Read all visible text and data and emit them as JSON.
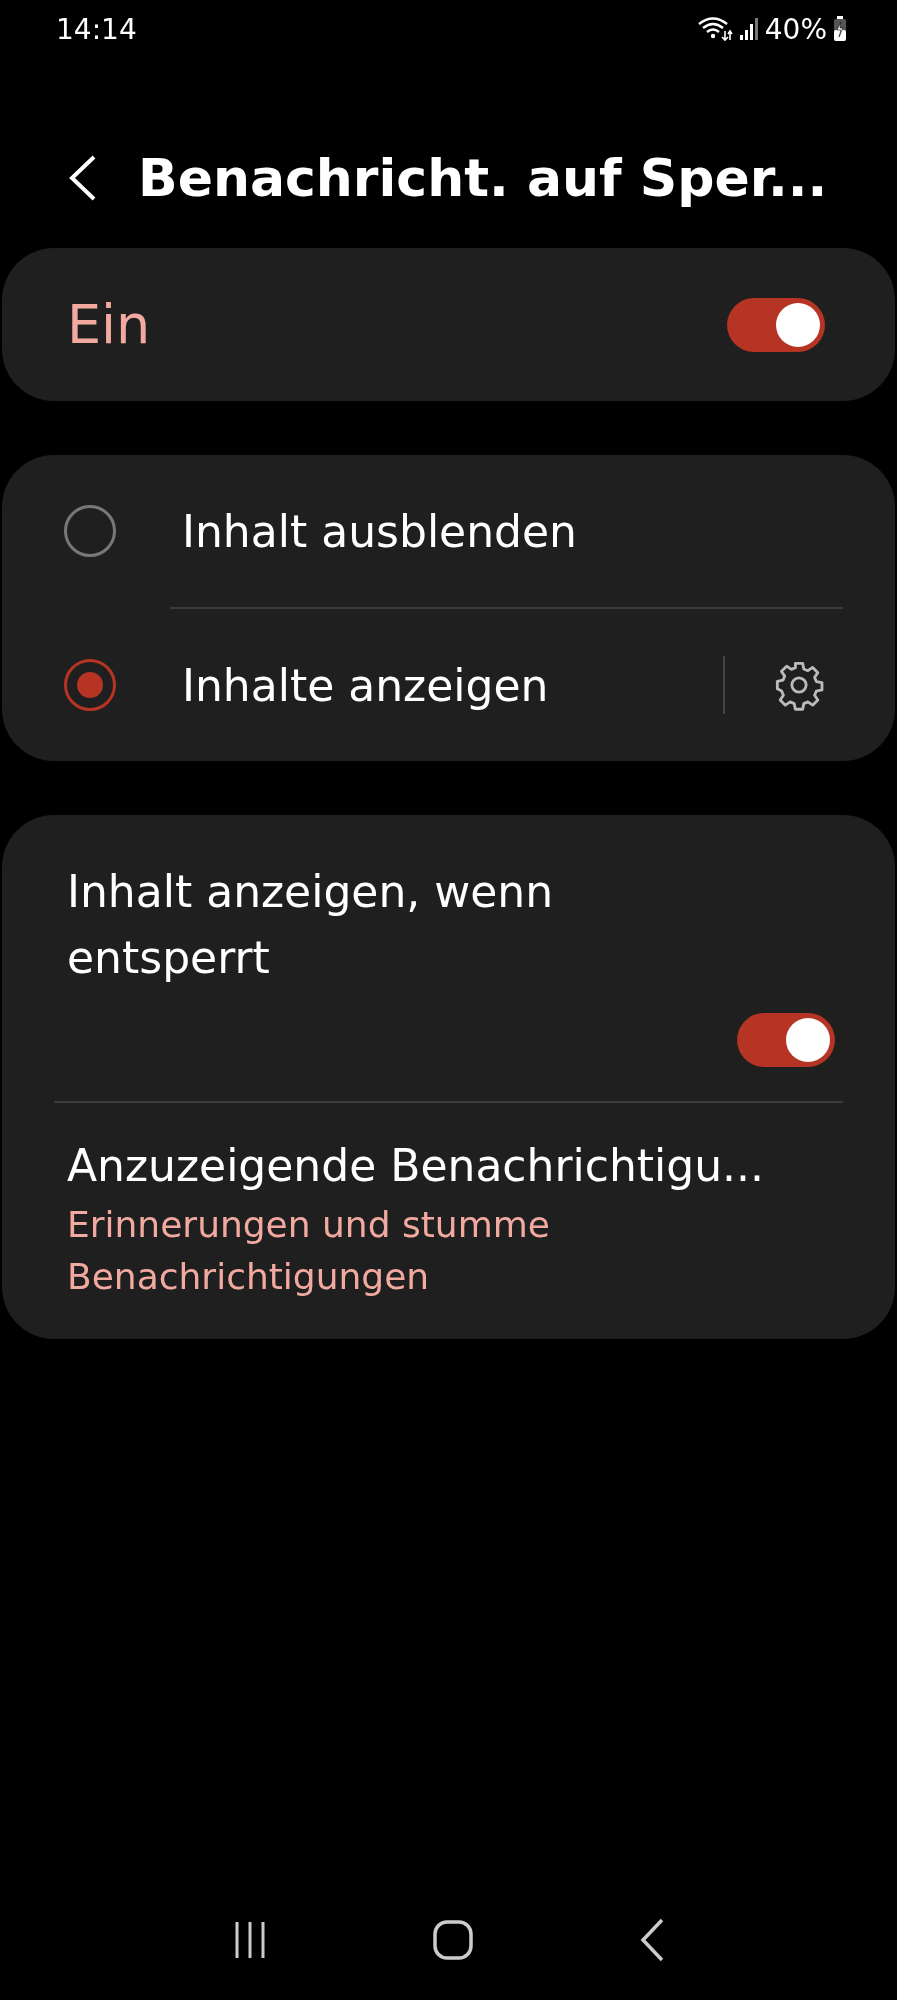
{
  "status_bar": {
    "time": "14:14",
    "battery": "40%"
  },
  "header": {
    "title": "Benachricht. auf Sper..."
  },
  "master": {
    "label": "Ein",
    "on": true
  },
  "options": [
    {
      "label": "Inhalt ausblenden",
      "selected": false,
      "kind": "plain"
    },
    {
      "label": "Inhalte anzeigen",
      "selected": true,
      "kind": "with-settings"
    }
  ],
  "settings": [
    {
      "kind": "toggle",
      "label": "Inhalt anzeigen, wenn entsperrt",
      "on": true
    },
    {
      "kind": "link",
      "label": "Anzuzeigende Benachrichtigu...",
      "summary": "Erinnerungen und stumme Benachrichtigungen"
    }
  ]
}
